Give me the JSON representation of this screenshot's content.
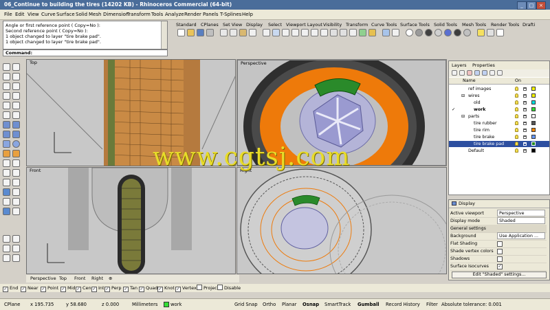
{
  "window": {
    "title": "06_Continue to building the tires (14202 KB) - Rhinoceros Commercial (64-bit)"
  },
  "menu": [
    "File",
    "Edit",
    "View",
    "Curve",
    "Surface",
    "Solid",
    "Mesh",
    "Dimension",
    "Transform",
    "Tools",
    "Analyze",
    "Render",
    "Panels",
    "T-Splines",
    "Help"
  ],
  "command": {
    "history": [
      "Angle or first reference point ( Copy=No ):",
      "Second reference point ( Copy=No ):",
      "1 object changed to layer \"tire brake pad\".",
      "1 object changed to layer \"tire brake pad\"."
    ],
    "prompt": "Command:"
  },
  "toolbar_tabs": [
    "Standard",
    "CPlanes",
    "Set View",
    "Display",
    "Select",
    "Viewport Layout",
    "Visibility",
    "Transform",
    "Curve Tools",
    "Surface Tools",
    "Solid Tools",
    "Mesh Tools",
    "Render Tools",
    "Drafti"
  ],
  "viewports": {
    "top": "Top",
    "perspective": "Perspective",
    "front": "Front",
    "right": "Right"
  },
  "viewport_tabs": [
    "Perspective",
    "Top",
    "Front",
    "Right"
  ],
  "layers_panel": {
    "tabs": [
      "Layers",
      "Properties"
    ],
    "columns": [
      "Name",
      "On"
    ],
    "rows": [
      {
        "name": "ref images",
        "color": "#ffff00"
      },
      {
        "name": "wires",
        "color": "#ffff00"
      },
      {
        "name": "old",
        "color": "#00e0e0"
      },
      {
        "name": "work",
        "color": "#33dd33",
        "current": true
      },
      {
        "name": "parts",
        "color": "#ffffff"
      },
      {
        "name": "tire rubber",
        "color": "#555555"
      },
      {
        "name": "tire rim",
        "color": "#ff8800"
      },
      {
        "name": "tire brake",
        "color": "#6699ff"
      },
      {
        "name": "tire brake pad",
        "color": "#228822",
        "selected": true
      },
      {
        "name": "Default",
        "color": "#000000"
      }
    ]
  },
  "display_panel": {
    "title": "Display",
    "active_viewport_label": "Active viewport",
    "active_viewport": "Perspective",
    "display_mode_label": "Display mode",
    "display_mode": "Shaded",
    "section": "General settings",
    "background_label": "Background",
    "background": "Use Application ...",
    "flat_shading": "Flat Shading",
    "shade_vertex_colors": "Shade vertex colors",
    "shadows": "Shadows",
    "surface_isocurves": "Surface Isocurves",
    "edit_button": "Edit \"Shaded\" settings..."
  },
  "osnaps": [
    {
      "label": "End",
      "checked": true
    },
    {
      "label": "Near",
      "checked": true
    },
    {
      "label": "Point",
      "checked": true
    },
    {
      "label": "Mid",
      "checked": true
    },
    {
      "label": "Cen",
      "checked": true
    },
    {
      "label": "Int",
      "checked": true
    },
    {
      "label": "Perp",
      "checked": true
    },
    {
      "label": "Tan",
      "checked": true
    },
    {
      "label": "Quad",
      "checked": true
    },
    {
      "label": "Knot",
      "checked": true
    },
    {
      "label": "Vertex",
      "checked": true
    },
    {
      "label": "Project",
      "checked": false
    },
    {
      "label": "Disable",
      "checked": false
    }
  ],
  "status": {
    "cplane": "CPlane",
    "x": "x 195.735",
    "y": "y 58.680",
    "z": "z 0.000",
    "units": "Millimeters",
    "layer": "work",
    "grid_snap": "Grid Snap",
    "ortho": "Ortho",
    "planar": "Planar",
    "osnap": "Osnap",
    "smarttrack": "SmartTrack",
    "gumball": "Gumball",
    "record_history": "Record History",
    "filter": "Filter",
    "tolerance": "Absolute tolerance: 0.001"
  },
  "watermark": "www.cgtsj.com",
  "colors": {
    "accent": "#4a6d9a",
    "rim": "#ee7a0a",
    "brake_pad": "#2a8a2a",
    "selection": "#2d4fa0"
  }
}
